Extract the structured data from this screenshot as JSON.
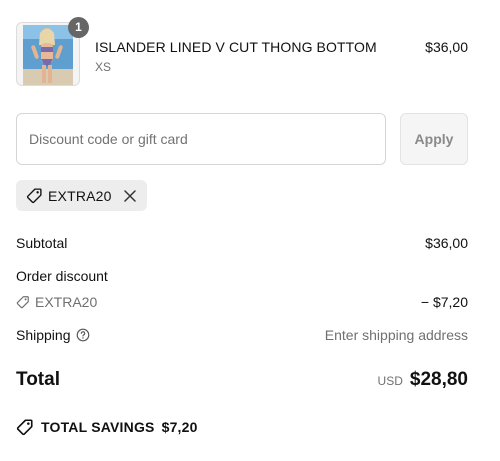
{
  "product": {
    "quantity": "1",
    "name": "ISLANDER LINED V CUT THONG BOTTOM",
    "variant": "XS",
    "price": "$36,00"
  },
  "discount": {
    "placeholder": "Discount code or gift card",
    "value": "",
    "apply_label": "Apply",
    "applied_code": "EXTRA20"
  },
  "summary": {
    "subtotal_label": "Subtotal",
    "subtotal_value": "$36,00",
    "order_discount_label": "Order discount",
    "discount_code": "EXTRA20",
    "discount_value": "− $7,20",
    "shipping_label": "Shipping",
    "shipping_value": "Enter shipping address",
    "total_label": "Total",
    "currency": "USD",
    "total_value": "$28,80",
    "savings_label": "TOTAL SAVINGS",
    "savings_value": "$7,20"
  },
  "colors": {
    "badge": "#666666",
    "chip_bg": "#ededed",
    "muted_text": "#707070"
  },
  "icons": {
    "discount_tag": "tag-icon",
    "remove": "close-icon",
    "shipping_help": "help-circle-icon"
  }
}
